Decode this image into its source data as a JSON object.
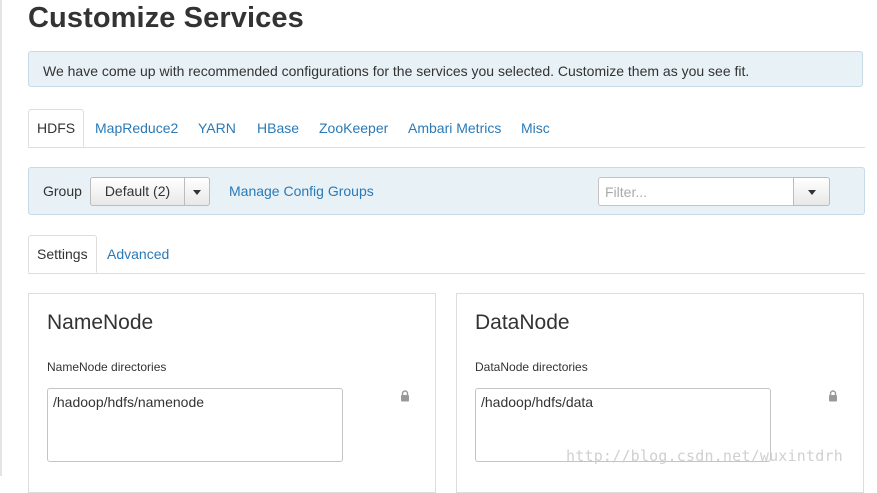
{
  "page": {
    "title": "Customize Services"
  },
  "alert": {
    "text": "We have come up with recommended configurations for the services you selected. Customize them as you see fit."
  },
  "service_tabs": [
    {
      "label": "HDFS",
      "active": true
    },
    {
      "label": "MapReduce2",
      "active": false
    },
    {
      "label": "YARN",
      "active": false
    },
    {
      "label": "HBase",
      "active": false
    },
    {
      "label": "ZooKeeper",
      "active": false
    },
    {
      "label": "Ambari Metrics",
      "active": false
    },
    {
      "label": "Misc",
      "active": false
    }
  ],
  "group_bar": {
    "label": "Group",
    "selected_group": "Default (2)",
    "manage_link": "Manage Config Groups",
    "filter_placeholder": "Filter..."
  },
  "sub_tabs": [
    {
      "label": "Settings",
      "active": true
    },
    {
      "label": "Advanced",
      "active": false
    }
  ],
  "panels": [
    {
      "title": "NameNode",
      "field_label": "NameNode directories",
      "value": "/hadoop/hdfs/namenode",
      "icon": "lock-icon"
    },
    {
      "title": "DataNode",
      "field_label": "DataNode directories",
      "value": "/hadoop/hdfs/data",
      "icon": "lock-icon"
    }
  ],
  "watermark": {
    "text": "http://blog.csdn.net/wuxintdrh"
  },
  "colors": {
    "link": "#2a7ab8",
    "alert_bg": "#e8f1f5",
    "alert_border": "#c6dbe5"
  }
}
